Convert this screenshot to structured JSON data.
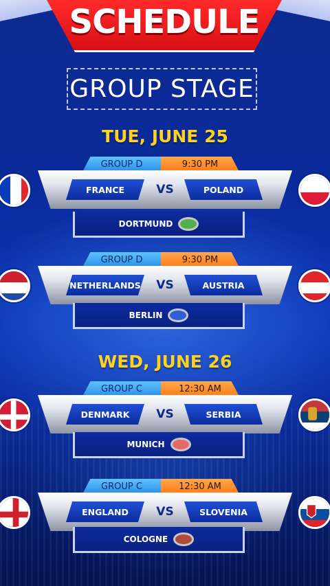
{
  "header": {
    "title": "SCHEDULE",
    "subtitle": "GROUP STAGE"
  },
  "days": [
    {
      "label": "TUE, JUNE 25",
      "matches": [
        {
          "group": "GROUP D",
          "time": "9:30 PM",
          "home": "FRANCE",
          "vs": "VS",
          "away": "POLAND",
          "venue": "DORTMUND",
          "home_flag": "france-flag",
          "away_flag": "poland-flag",
          "stadium_icon": "stadium-icon"
        },
        {
          "group": "GROUP D",
          "time": "9:30 PM",
          "home": "NETHERLANDS",
          "vs": "VS",
          "away": "AUSTRIA",
          "venue": "BERLIN",
          "home_flag": "netherlands-flag",
          "away_flag": "austria-flag",
          "stadium_icon": "stadium-icon"
        }
      ]
    },
    {
      "label": "WED, JUNE 26",
      "matches": [
        {
          "group": "GROUP C",
          "time": "12:30 AM",
          "home": "DENMARK",
          "vs": "VS",
          "away": "SERBIA",
          "venue": "MUNICH",
          "home_flag": "denmark-flag",
          "away_flag": "serbia-flag",
          "stadium_icon": "stadium-icon"
        },
        {
          "group": "GROUP C",
          "time": "12:30 AM",
          "home": "ENGLAND",
          "vs": "VS",
          "away": "SLOVENIA",
          "venue": "COLOGNE",
          "home_flag": "england-flag",
          "away_flag": "slovenia-flag",
          "stadium_icon": "stadium-icon"
        }
      ]
    }
  ],
  "colors": {
    "banner": "#e0141a",
    "day_label": "#ffd21e",
    "background": "#0a2a9a",
    "group_tag": "#2b8fe6",
    "time_tag": "#ff7a1a"
  }
}
